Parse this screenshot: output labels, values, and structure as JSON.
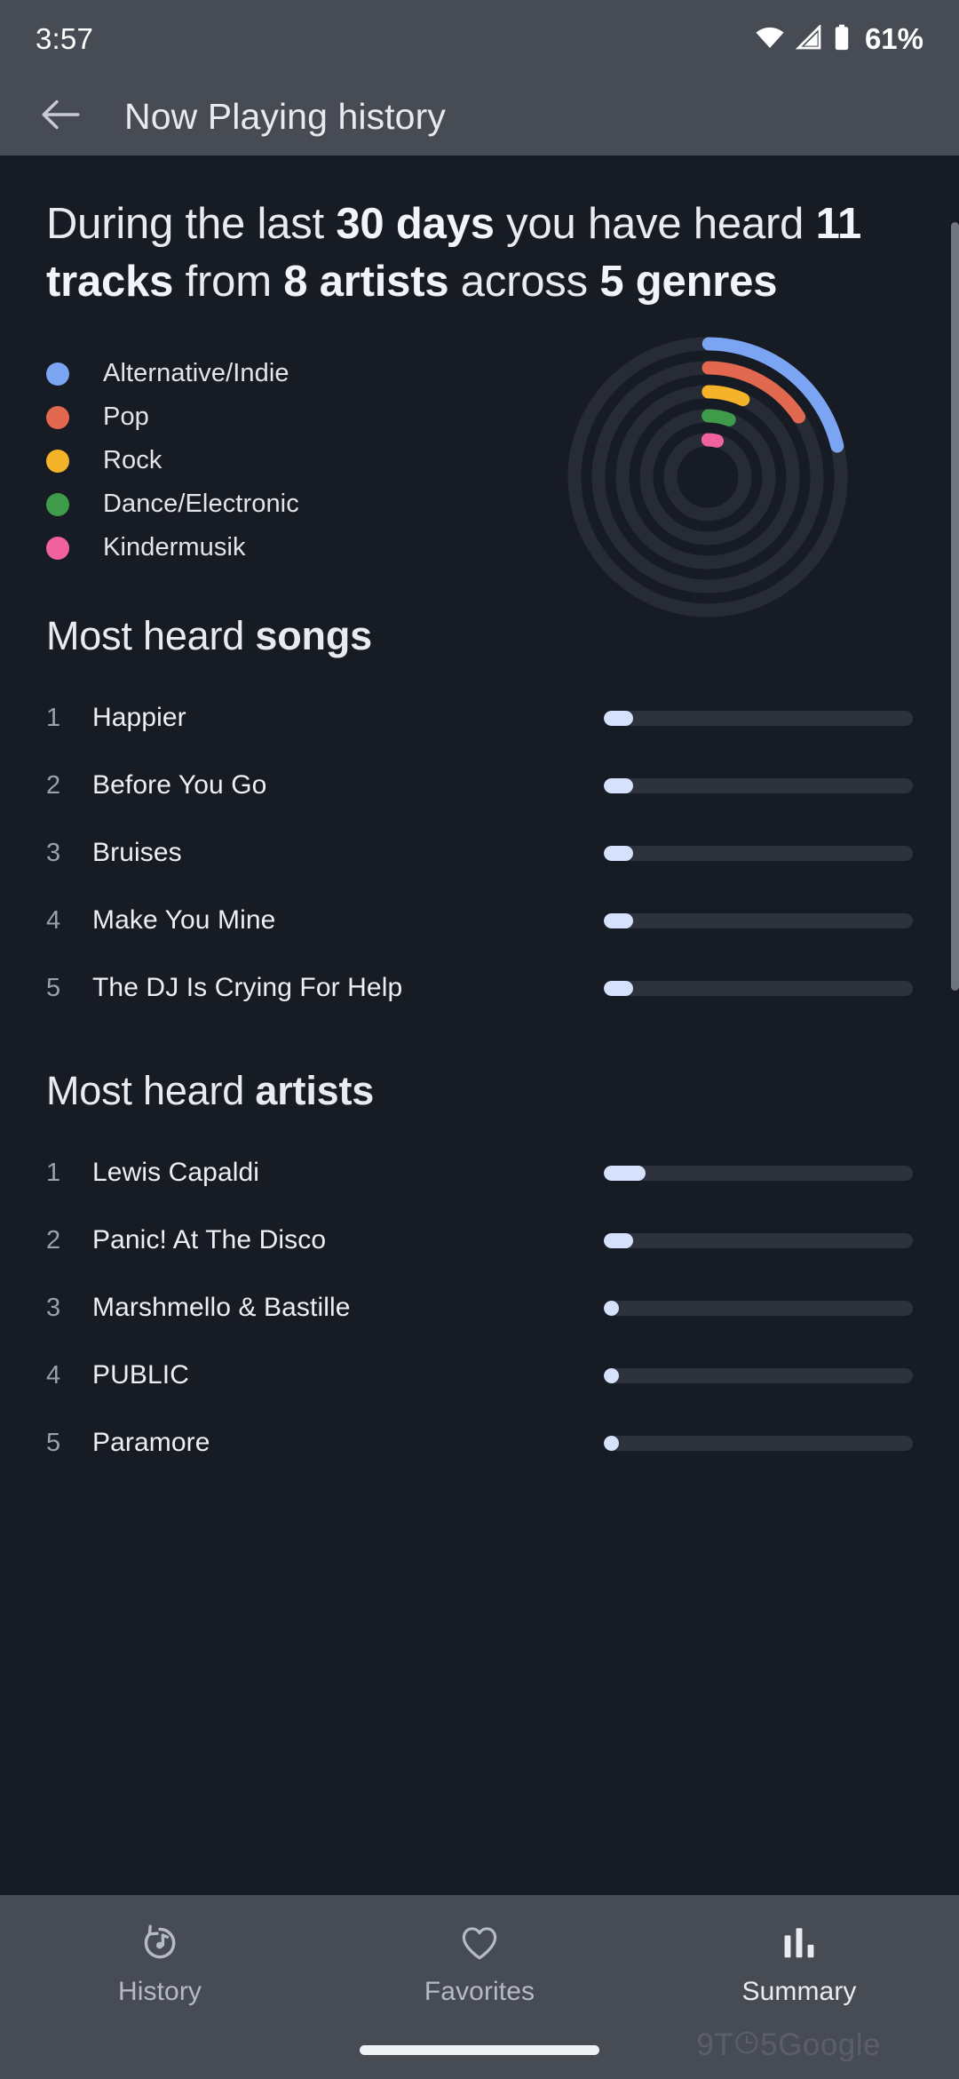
{
  "status_bar": {
    "time": "3:57",
    "battery_percent": "61%",
    "icons": [
      "wifi-icon",
      "cell-signal-icon",
      "battery-icon"
    ]
  },
  "app_bar": {
    "back_icon": "back-arrow-icon",
    "title": "Now Playing history"
  },
  "summary": {
    "headline_parts": [
      {
        "text": "During the last ",
        "bold": false
      },
      {
        "text": "30 days",
        "bold": true
      },
      {
        "text": " you have heard ",
        "bold": false
      },
      {
        "text": "11 tracks",
        "bold": true
      },
      {
        "text": " from ",
        "bold": false
      },
      {
        "text": "8 artists",
        "bold": true
      },
      {
        "text": " across ",
        "bold": false
      },
      {
        "text": "5 genres",
        "bold": true
      }
    ],
    "days": "30 days",
    "tracks": "11 tracks",
    "artists": "8 artists",
    "genres": "5 genres"
  },
  "chart_data": {
    "type": "pie",
    "title": "Genres heard in the last 30 days",
    "subtype": "concentric-radial-rings",
    "legend_position": "left",
    "categories": [
      "Alternative/Indie",
      "Pop",
      "Rock",
      "Dance/Electronic",
      "Kindermusik"
    ],
    "values": [
      4,
      3,
      2,
      1,
      1
    ],
    "sweep_degrees": [
      76,
      56,
      24,
      20,
      14
    ],
    "colors": [
      "#7BA4F2",
      "#E2684F",
      "#F4B328",
      "#3E9B49",
      "#F2619F"
    ],
    "track_color": "#272b35",
    "start_angle_deg": 0,
    "ring_count": 5,
    "ylabel": "",
    "xlabel": ""
  },
  "songs_section": {
    "title_plain": "Most heard ",
    "title_bold": "songs",
    "max_value": 3,
    "rows": [
      {
        "rank": "1",
        "label": "Happier",
        "value": 3,
        "fill_percent": 9.5
      },
      {
        "rank": "2",
        "label": "Before You Go",
        "value": 3,
        "fill_percent": 9.5
      },
      {
        "rank": "3",
        "label": "Bruises",
        "value": 3,
        "fill_percent": 9.5
      },
      {
        "rank": "4",
        "label": "Make You Mine",
        "value": 3,
        "fill_percent": 9.5
      },
      {
        "rank": "5",
        "label": "The DJ Is Crying For Help",
        "value": 3,
        "fill_percent": 9.5
      }
    ]
  },
  "artists_section": {
    "title_plain": "Most heard ",
    "title_bold": "artists",
    "max_value": 4,
    "rows": [
      {
        "rank": "1",
        "label": "Lewis Capaldi",
        "value": 4,
        "fill_percent": 13.5
      },
      {
        "rank": "2",
        "label": "Panic! At The Disco",
        "value": 3,
        "fill_percent": 9.5
      },
      {
        "rank": "3",
        "label": "Marshmello & Bastille",
        "value": 1,
        "fill_percent": 3.8
      },
      {
        "rank": "4",
        "label": "PUBLIC",
        "value": 1,
        "fill_percent": 3.8
      },
      {
        "rank": "5",
        "label": "Paramore",
        "value": 1,
        "fill_percent": 3.8
      }
    ]
  },
  "bottom_nav": {
    "items": [
      {
        "label": "History",
        "icon": "history-music-icon",
        "active": false
      },
      {
        "label": "Favorites",
        "icon": "heart-outline-icon",
        "active": false
      },
      {
        "label": "Summary",
        "icon": "bar-chart-icon",
        "active": true
      }
    ]
  },
  "watermark": {
    "prefix": "9T",
    "suffix": "5Google"
  },
  "colors": {
    "page_background": "#171b23",
    "chrome_background": "#474b54",
    "bar_track": "#2e323c",
    "bar_fill": "#d6e2fb",
    "accent_blue": "#7BA4F2"
  }
}
